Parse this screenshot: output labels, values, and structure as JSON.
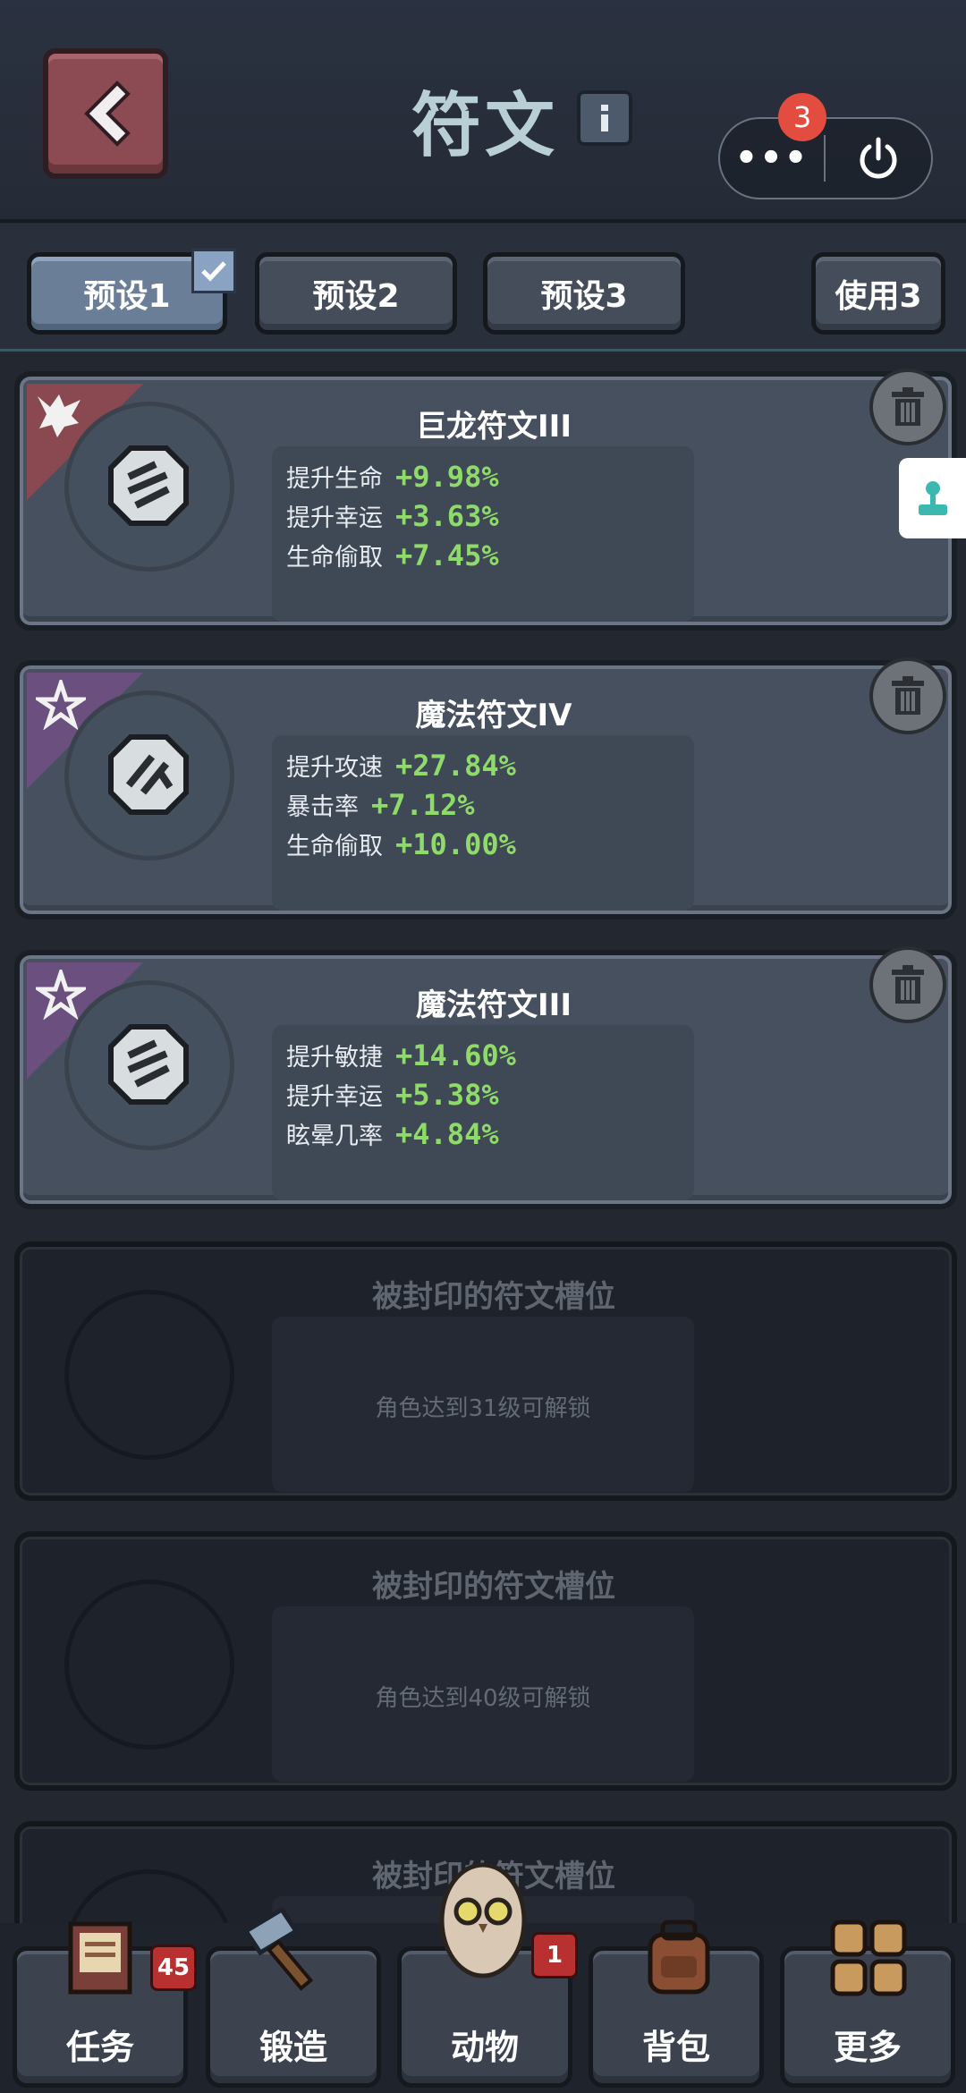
{
  "header": {
    "title": "符文",
    "badge_count": "3",
    "more_label": "•••"
  },
  "tabs": [
    {
      "label": "预设1",
      "active": true
    },
    {
      "label": "预设2",
      "active": false
    },
    {
      "label": "预设3",
      "active": false
    },
    {
      "label": "使用3",
      "active": false
    }
  ],
  "cards": [
    {
      "name": "巨龙符文III",
      "corner_color": "#8a4850",
      "stats": [
        {
          "label": "提升生命",
          "value": "+9.98%"
        },
        {
          "label": "提升幸运",
          "value": "+3.63%"
        },
        {
          "label": "生命偷取",
          "value": "+7.45%"
        }
      ]
    },
    {
      "name": "魔法符文IV",
      "corner_color": "#6b4f7e",
      "stats": [
        {
          "label": "提升攻速",
          "value": "+27.84%"
        },
        {
          "label": "暴击率",
          "value": "+7.12%"
        },
        {
          "label": "生命偷取",
          "value": "+10.00%"
        }
      ]
    },
    {
      "name": "魔法符文III",
      "corner_color": "#6b4f7e",
      "stats": [
        {
          "label": "提升敏捷",
          "value": "+14.60%"
        },
        {
          "label": "提升幸运",
          "value": "+5.38%"
        },
        {
          "label": "眩晕几率",
          "value": "+4.84%"
        }
      ]
    }
  ],
  "locked_slots": [
    {
      "name": "被封印的符文槽位",
      "requirement": "角色达到31级可解锁"
    },
    {
      "name": "被封印的符文槽位",
      "requirement": "角色达到40级可解锁"
    },
    {
      "name": "被封印的符文槽位"
    }
  ],
  "nav": [
    {
      "label": "任务",
      "badge": "45",
      "icon": "quest-book-icon"
    },
    {
      "label": "锻造",
      "icon": "hammer-icon"
    },
    {
      "label": "动物",
      "badge": "1",
      "icon": "owl-pet-icon"
    },
    {
      "label": "背包",
      "icon": "backpack-icon"
    },
    {
      "label": "更多",
      "icon": "grid-more-icon"
    }
  ],
  "colors": {
    "stat_value": "#8fdb6a",
    "badge_red": "#e34d3f",
    "back_button": "#8c4b52"
  }
}
